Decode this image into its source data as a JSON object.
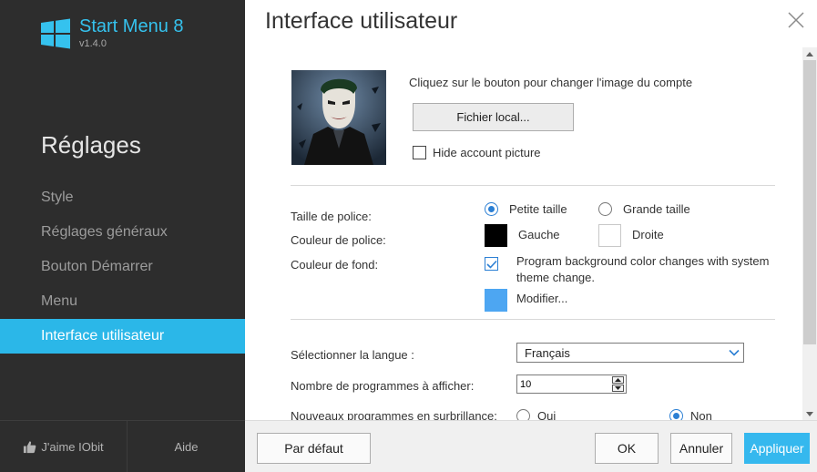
{
  "app": {
    "name": "Start Menu 8",
    "version": "v1.4.0"
  },
  "sidebar": {
    "heading": "Réglages",
    "items": [
      {
        "label": "Style"
      },
      {
        "label": "Réglages généraux"
      },
      {
        "label": "Bouton Démarrer"
      },
      {
        "label": "Menu"
      },
      {
        "label": "Interface utilisateur"
      }
    ],
    "active_index": 4,
    "footer": {
      "like_label": "J'aime IObit",
      "help_label": "Aide"
    }
  },
  "header": {
    "title": "Interface utilisateur"
  },
  "account": {
    "caption": "Cliquez sur le bouton pour changer l'image du compte",
    "local_file_button": "Fichier local...",
    "hide_picture_label": "Hide account picture",
    "hide_picture_checked": false
  },
  "font": {
    "size_label": "Taille de police:",
    "size_options": [
      {
        "label": "Petite taille",
        "selected": true
      },
      {
        "label": "Grande taille",
        "selected": false
      }
    ],
    "color_label": "Couleur de police:",
    "color_options": [
      {
        "label": "Gauche",
        "color": "#000000"
      },
      {
        "label": "Droite",
        "color": "#ffffff"
      }
    ]
  },
  "background": {
    "label": "Couleur de fond:",
    "sync_label": "Program background color changes with system theme change.",
    "sync_checked": true,
    "color": "#4da6f2",
    "modify_label": "Modifier..."
  },
  "language": {
    "label": "Sélectionner la langue :",
    "selected": "Français"
  },
  "programs": {
    "label": "Nombre de programmes à afficher:",
    "value": "10"
  },
  "highlight": {
    "label": "Nouveaux programmes en surbrillance:",
    "options": [
      {
        "label": "Oui",
        "selected": false
      },
      {
        "label": "Non",
        "selected": true
      }
    ]
  },
  "buttons": {
    "default": "Par défaut",
    "ok": "OK",
    "cancel": "Annuler",
    "apply": "Appliquer"
  },
  "colors": {
    "sidebar_bg": "#2d2d2d",
    "accent": "#2bb7e8",
    "apply_bg": "#35b8ee"
  }
}
